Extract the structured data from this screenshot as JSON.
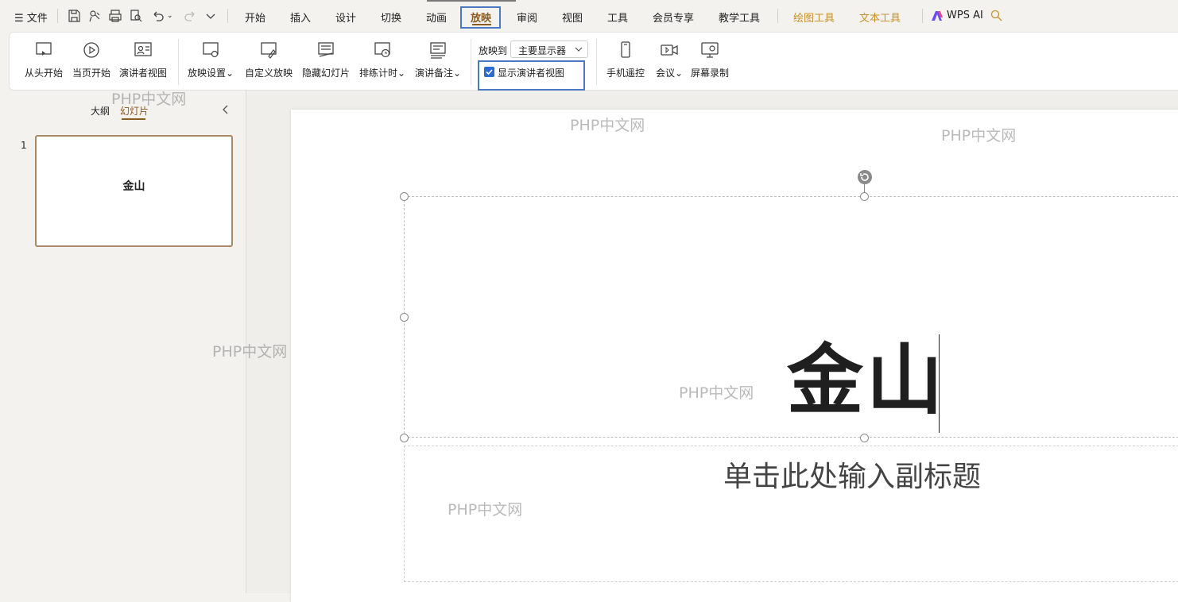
{
  "menubar": {
    "file_label": "文件",
    "tabs": [
      "开始",
      "插入",
      "设计",
      "切换",
      "动画",
      "放映",
      "审阅",
      "视图",
      "工具",
      "会员专享",
      "教学工具"
    ],
    "context_tabs": [
      "绘图工具",
      "文本工具"
    ],
    "ai_label": "WPS AI",
    "active_tab": "放映"
  },
  "ribbon": {
    "buttons": [
      "从头开始",
      "当页开始",
      "演讲者视图",
      "放映设置",
      "自定义放映",
      "隐藏幻灯片",
      "排练计时",
      "演讲备注"
    ],
    "play_to_label": "放映到",
    "play_to_value": "主要显示器",
    "presenter_view_checkbox": "显示演讲者视图",
    "presenter_view_checked": true,
    "right_buttons": [
      "手机遥控",
      "会议",
      "屏幕录制"
    ]
  },
  "left_panel": {
    "tab_outline": "大纲",
    "tab_slides": "幻灯片",
    "slide_number": "1",
    "thumb_title": "金山"
  },
  "slide": {
    "title": "金山",
    "subtitle_placeholder": "单击此处输入副标题"
  },
  "watermark": "PHP中文网",
  "colors": {
    "accent_brown": "#8a5a1e",
    "context_tab_orange": "#c8902a",
    "highlight_box": "#4a78c2",
    "checkbox_blue": "#2c6bd2"
  }
}
